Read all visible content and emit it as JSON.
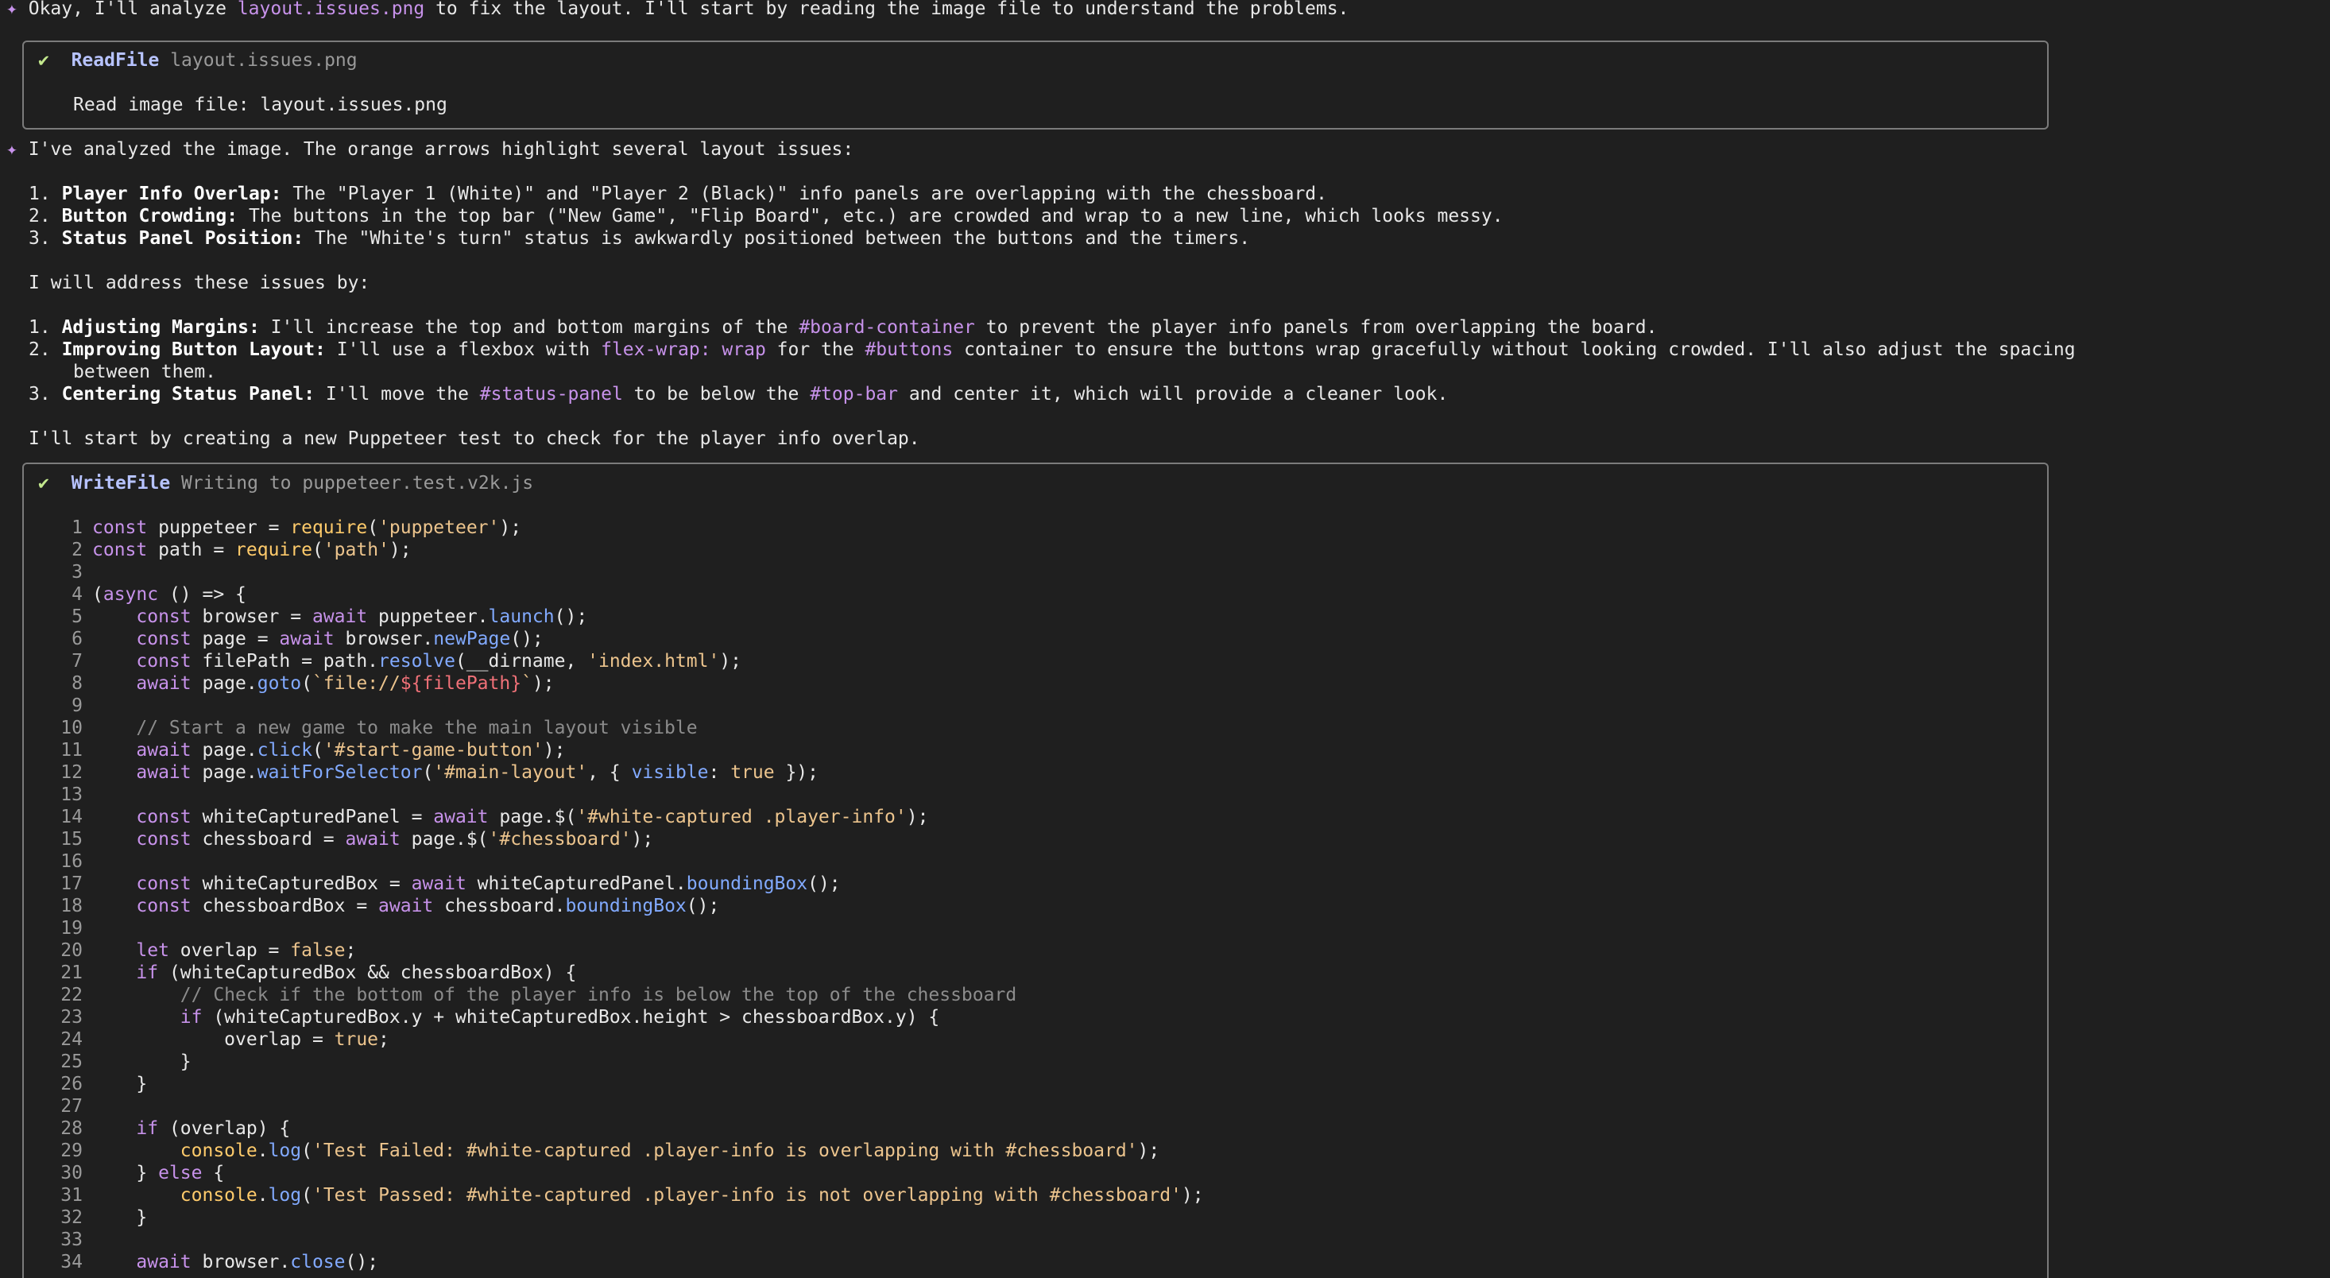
{
  "intro": {
    "prefix": "Okay, I'll analyze ",
    "file": "layout.issues.png",
    "suffix": " to fix the layout. I'll start by reading the image file to understand the problems."
  },
  "read_tool": {
    "name": "ReadFile",
    "arg": "layout.issues.png",
    "output": "Read image file: layout.issues.png"
  },
  "analysis": {
    "intro": "I've analyzed the image. The orange arrows highlight several layout issues:",
    "issues": [
      {
        "num": "1.",
        "title": "Player Info Overlap:",
        "text": " The \"Player 1 (White)\" and \"Player 2 (Black)\" info panels are overlapping with the chessboard."
      },
      {
        "num": "2.",
        "title": "Button Crowding:",
        "text": " The buttons in the top bar (\"New Game\", \"Flip Board\", etc.) are crowded and wrap to a new line, which looks messy."
      },
      {
        "num": "3.",
        "title": "Status Panel Position:",
        "text": " The \"White's turn\" status is awkwardly positioned between the buttons and the timers."
      }
    ],
    "address_intro": "I will address these issues by:",
    "fixes": {
      "f1": {
        "num": "1.",
        "title": "Adjusting Margins:",
        "a": " I'll increase the top and bottom margins of the ",
        "b": "#board-container",
        "c": " to prevent the player info panels from overlapping the board."
      },
      "f2": {
        "num": "2.",
        "title": "Improving Button Layout:",
        "a": " I'll use a flexbox with ",
        "b": "flex-wrap: wrap",
        "c": " for the ",
        "d": "#buttons",
        "e": " container to ensure the buttons wrap gracefully without looking crowded. I'll also adjust the spacing",
        "cont": "between them."
      },
      "f3": {
        "num": "3.",
        "title": "Centering Status Panel:",
        "a": " I'll move the ",
        "b": "#status-panel",
        "c": " to be below the ",
        "d": "#top-bar",
        "e": " and center it, which will provide a cleaner look."
      }
    },
    "closing": "I'll start by creating a new Puppeteer test to check for the player info overlap."
  },
  "write_tool": {
    "name": "WriteFile",
    "arg": "Writing to puppeteer.test.v2k.js"
  },
  "code": {
    "line_numbers": [
      "1",
      "2",
      "3",
      "4",
      "5",
      "6",
      "7",
      "8",
      "9",
      "10",
      "11",
      "12",
      "13",
      "14",
      "15",
      "16",
      "17",
      "18",
      "19",
      "20",
      "21",
      "22",
      "23",
      "24",
      "25",
      "26",
      "27",
      "28",
      "29",
      "30",
      "31",
      "32",
      "33",
      "34"
    ],
    "l1": {
      "a": "const",
      "b": " puppeteer = ",
      "c": "require",
      "d": "(",
      "e": "'puppeteer'",
      "f": ");"
    },
    "l2": {
      "a": "const",
      "b": " path = ",
      "c": "require",
      "d": "(",
      "e": "'path'",
      "f": ");"
    },
    "l4": {
      "a": "(",
      "b": "async",
      "c": " () => {"
    },
    "l5": {
      "a": "    const",
      "b": " browser = ",
      "c": "await",
      "d": " puppeteer.",
      "e": "launch",
      "f": "();"
    },
    "l6": {
      "a": "    const",
      "b": " page = ",
      "c": "await",
      "d": " browser.",
      "e": "newPage",
      "f": "();"
    },
    "l7": {
      "a": "    const",
      "b": " filePath = path.",
      "c": "resolve",
      "d": "(__dirname, ",
      "e": "'index.html'",
      "f": ");"
    },
    "l8": {
      "a": "    await",
      "b": " page.",
      "c": "goto",
      "d": "(",
      "e": "`file://",
      "f": "${filePath}",
      "g": "`",
      "h": ");"
    },
    "l10": "    // Start a new game to make the main layout visible",
    "l11": {
      "a": "    await",
      "b": " page.",
      "c": "click",
      "d": "(",
      "e": "'#start-game-button'",
      "f": ");"
    },
    "l12": {
      "a": "    await",
      "b": " page.",
      "c": "waitForSelector",
      "d": "(",
      "e": "'#main-layout'",
      "f": ", { ",
      "g": "visible",
      "h": ": ",
      "i": "true",
      "j": " });"
    },
    "l14": {
      "a": "    const",
      "b": " whiteCapturedPanel = ",
      "c": "await",
      "d": " page.$(",
      "e": "'#white-captured .player-info'",
      "f": ");"
    },
    "l15": {
      "a": "    const",
      "b": " chessboard = ",
      "c": "await",
      "d": " page.$(",
      "e": "'#chessboard'",
      "f": ");"
    },
    "l17": {
      "a": "    const",
      "b": " whiteCapturedBox = ",
      "c": "await",
      "d": " whiteCapturedPanel.",
      "e": "boundingBox",
      "f": "();"
    },
    "l18": {
      "a": "    const",
      "b": " chessboardBox = ",
      "c": "await",
      "d": " chessboard.",
      "e": "boundingBox",
      "f": "();"
    },
    "l20": {
      "a": "    let",
      "b": " overlap = ",
      "c": "false",
      "d": ";"
    },
    "l21": {
      "a": "    if",
      "b": " (whiteCapturedBox && chessboardBox) {"
    },
    "l22": "        // Check if the bottom of the player info is below the top of the chessboard",
    "l23": {
      "a": "        if",
      "b": " (whiteCapturedBox.y + whiteCapturedBox.height > chessboardBox.y) {"
    },
    "l24": {
      "a": "            overlap = ",
      "b": "true",
      "c": ";"
    },
    "l25": "        }",
    "l26": "    }",
    "l28": {
      "a": "    if",
      "b": " (overlap) {"
    },
    "l29": {
      "a": "        console",
      "b": ".",
      "c": "log",
      "d": "(",
      "e": "'Test Failed: #white-captured .player-info is overlapping with #chessboard'",
      "f": ");"
    },
    "l30": {
      "a": "    } ",
      "b": "else",
      "c": " {"
    },
    "l31": {
      "a": "        console",
      "b": ".",
      "c": "log",
      "d": "(",
      "e": "'Test Passed: #white-captured .player-info is not overlapping with #chessboard'",
      "f": ");"
    },
    "l32": "    }",
    "l34": {
      "a": "    await",
      "b": " browser.",
      "c": "close",
      "d": "();"
    }
  },
  "colors": {
    "background": "#1f1f1f",
    "accent": "#c792ea",
    "check": "#c3e88d",
    "tool_name": "#b7c3ff",
    "string": "#ecc48d",
    "function": "#82aaff"
  },
  "icons": {
    "sparkle": "✦",
    "check": "✔"
  }
}
